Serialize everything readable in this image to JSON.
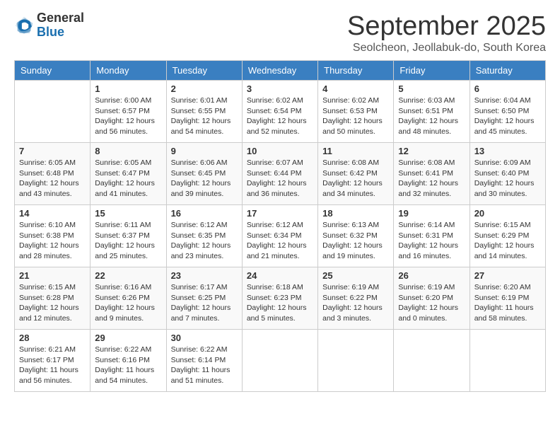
{
  "logo": {
    "general": "General",
    "blue": "Blue"
  },
  "title": "September 2025",
  "subtitle": "Seolcheon, Jeollabuk-do, South Korea",
  "days_of_week": [
    "Sunday",
    "Monday",
    "Tuesday",
    "Wednesday",
    "Thursday",
    "Friday",
    "Saturday"
  ],
  "weeks": [
    [
      {
        "day": "",
        "info": ""
      },
      {
        "day": "1",
        "info": "Sunrise: 6:00 AM\nSunset: 6:57 PM\nDaylight: 12 hours\nand 56 minutes."
      },
      {
        "day": "2",
        "info": "Sunrise: 6:01 AM\nSunset: 6:55 PM\nDaylight: 12 hours\nand 54 minutes."
      },
      {
        "day": "3",
        "info": "Sunrise: 6:02 AM\nSunset: 6:54 PM\nDaylight: 12 hours\nand 52 minutes."
      },
      {
        "day": "4",
        "info": "Sunrise: 6:02 AM\nSunset: 6:53 PM\nDaylight: 12 hours\nand 50 minutes."
      },
      {
        "day": "5",
        "info": "Sunrise: 6:03 AM\nSunset: 6:51 PM\nDaylight: 12 hours\nand 48 minutes."
      },
      {
        "day": "6",
        "info": "Sunrise: 6:04 AM\nSunset: 6:50 PM\nDaylight: 12 hours\nand 45 minutes."
      }
    ],
    [
      {
        "day": "7",
        "info": "Sunrise: 6:05 AM\nSunset: 6:48 PM\nDaylight: 12 hours\nand 43 minutes."
      },
      {
        "day": "8",
        "info": "Sunrise: 6:05 AM\nSunset: 6:47 PM\nDaylight: 12 hours\nand 41 minutes."
      },
      {
        "day": "9",
        "info": "Sunrise: 6:06 AM\nSunset: 6:45 PM\nDaylight: 12 hours\nand 39 minutes."
      },
      {
        "day": "10",
        "info": "Sunrise: 6:07 AM\nSunset: 6:44 PM\nDaylight: 12 hours\nand 36 minutes."
      },
      {
        "day": "11",
        "info": "Sunrise: 6:08 AM\nSunset: 6:42 PM\nDaylight: 12 hours\nand 34 minutes."
      },
      {
        "day": "12",
        "info": "Sunrise: 6:08 AM\nSunset: 6:41 PM\nDaylight: 12 hours\nand 32 minutes."
      },
      {
        "day": "13",
        "info": "Sunrise: 6:09 AM\nSunset: 6:40 PM\nDaylight: 12 hours\nand 30 minutes."
      }
    ],
    [
      {
        "day": "14",
        "info": "Sunrise: 6:10 AM\nSunset: 6:38 PM\nDaylight: 12 hours\nand 28 minutes."
      },
      {
        "day": "15",
        "info": "Sunrise: 6:11 AM\nSunset: 6:37 PM\nDaylight: 12 hours\nand 25 minutes."
      },
      {
        "day": "16",
        "info": "Sunrise: 6:12 AM\nSunset: 6:35 PM\nDaylight: 12 hours\nand 23 minutes."
      },
      {
        "day": "17",
        "info": "Sunrise: 6:12 AM\nSunset: 6:34 PM\nDaylight: 12 hours\nand 21 minutes."
      },
      {
        "day": "18",
        "info": "Sunrise: 6:13 AM\nSunset: 6:32 PM\nDaylight: 12 hours\nand 19 minutes."
      },
      {
        "day": "19",
        "info": "Sunrise: 6:14 AM\nSunset: 6:31 PM\nDaylight: 12 hours\nand 16 minutes."
      },
      {
        "day": "20",
        "info": "Sunrise: 6:15 AM\nSunset: 6:29 PM\nDaylight: 12 hours\nand 14 minutes."
      }
    ],
    [
      {
        "day": "21",
        "info": "Sunrise: 6:15 AM\nSunset: 6:28 PM\nDaylight: 12 hours\nand 12 minutes."
      },
      {
        "day": "22",
        "info": "Sunrise: 6:16 AM\nSunset: 6:26 PM\nDaylight: 12 hours\nand 9 minutes."
      },
      {
        "day": "23",
        "info": "Sunrise: 6:17 AM\nSunset: 6:25 PM\nDaylight: 12 hours\nand 7 minutes."
      },
      {
        "day": "24",
        "info": "Sunrise: 6:18 AM\nSunset: 6:23 PM\nDaylight: 12 hours\nand 5 minutes."
      },
      {
        "day": "25",
        "info": "Sunrise: 6:19 AM\nSunset: 6:22 PM\nDaylight: 12 hours\nand 3 minutes."
      },
      {
        "day": "26",
        "info": "Sunrise: 6:19 AM\nSunset: 6:20 PM\nDaylight: 12 hours\nand 0 minutes."
      },
      {
        "day": "27",
        "info": "Sunrise: 6:20 AM\nSunset: 6:19 PM\nDaylight: 11 hours\nand 58 minutes."
      }
    ],
    [
      {
        "day": "28",
        "info": "Sunrise: 6:21 AM\nSunset: 6:17 PM\nDaylight: 11 hours\nand 56 minutes."
      },
      {
        "day": "29",
        "info": "Sunrise: 6:22 AM\nSunset: 6:16 PM\nDaylight: 11 hours\nand 54 minutes."
      },
      {
        "day": "30",
        "info": "Sunrise: 6:22 AM\nSunset: 6:14 PM\nDaylight: 11 hours\nand 51 minutes."
      },
      {
        "day": "",
        "info": ""
      },
      {
        "day": "",
        "info": ""
      },
      {
        "day": "",
        "info": ""
      },
      {
        "day": "",
        "info": ""
      }
    ]
  ]
}
